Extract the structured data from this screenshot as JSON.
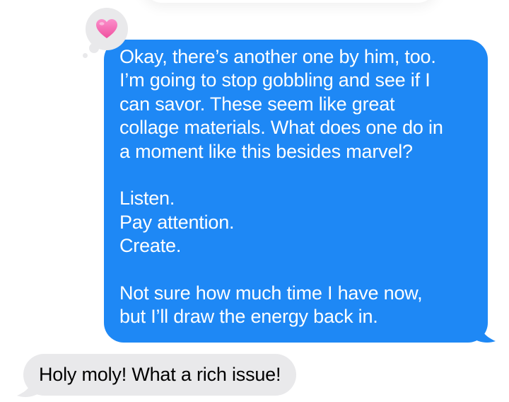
{
  "thread": {
    "tapback": {
      "icon": "heart-icon",
      "color": "#f576b8"
    },
    "sent_message": {
      "bubble_color": "#1e88f5",
      "paragraphs": [
        "Okay, there’s another one by him, too.\nI’m going to stop gobbling and see if I\ncan savor. These seem like great\ncollage materials. What does one do in\na moment like this besides marvel?",
        "Listen.\nPay attention.\nCreate.",
        "Not sure how much time I have now,\nbut I’ll draw the energy back in."
      ]
    },
    "received_message": {
      "bubble_color": "#e9e9eb",
      "text": "Holy moly! What a rich issue!"
    }
  }
}
